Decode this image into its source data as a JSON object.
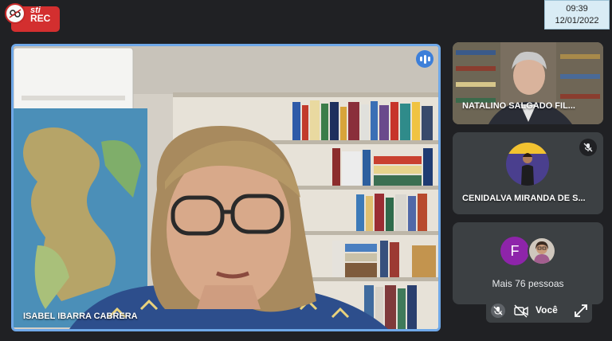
{
  "recording": {
    "brand": "sti",
    "label": "REC",
    "color": "#d32f2f"
  },
  "clock": {
    "time": "09:39",
    "date": "12/01/2022"
  },
  "main_speaker": {
    "name": "ISABEL IBARRA CABRERA",
    "speaking_icon": "speaking-bars-icon",
    "border_color": "#6fa8e8"
  },
  "participants": [
    {
      "name": "NATALINO SALGADO FIL...",
      "muted": false
    },
    {
      "name": "CENIDALVA MIRANDA DE S...",
      "muted": true,
      "mute_icon": "mic-off-icon"
    }
  ],
  "others": {
    "avatar_letter": "F",
    "avatar_color": "#8e24aa",
    "label": "Mais 76 pessoas"
  },
  "self_view": {
    "label": "Você",
    "icons": [
      "mic-off-icon",
      "camera-off-icon",
      "expand-icon"
    ]
  }
}
